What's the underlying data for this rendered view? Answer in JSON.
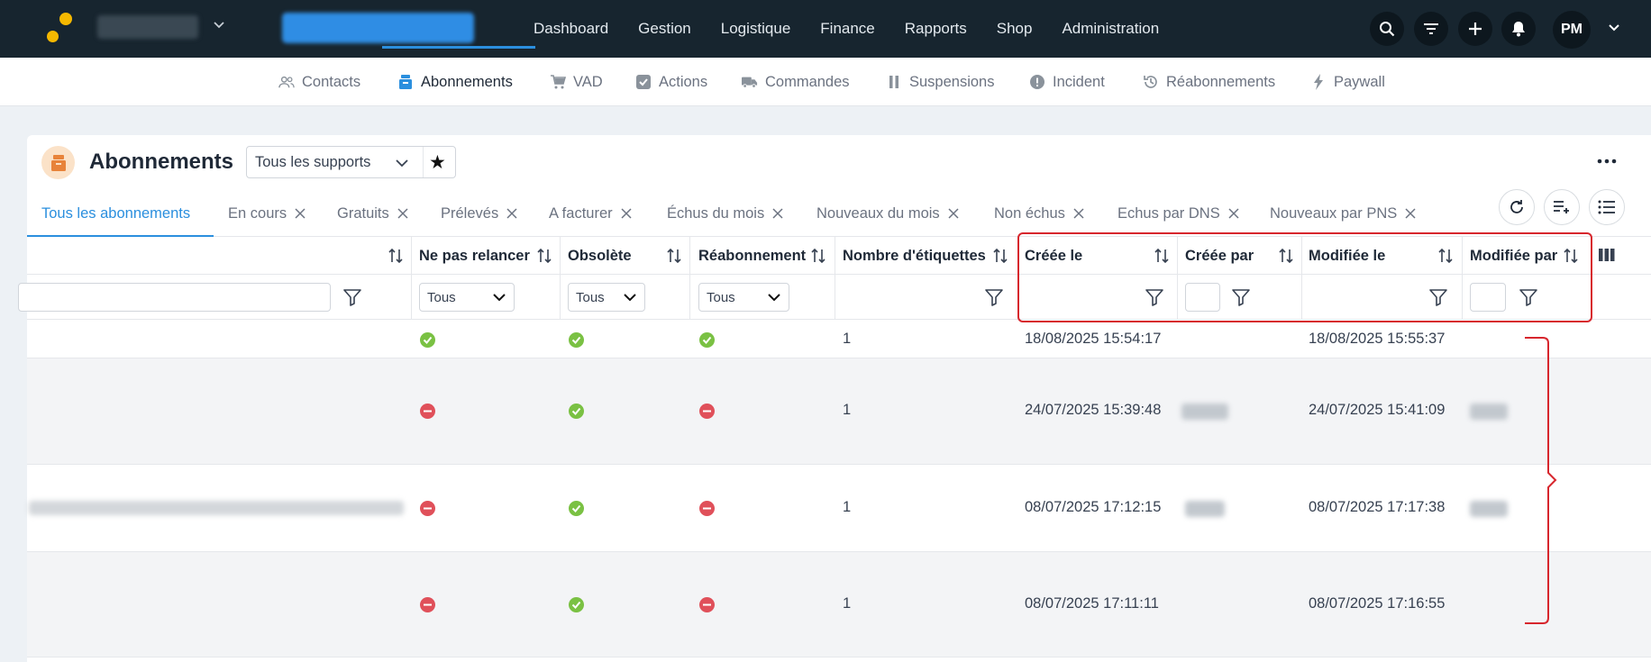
{
  "topbar": {
    "nav": [
      "Dashboard",
      "Gestion",
      "Logistique",
      "Finance",
      "Rapports",
      "Shop",
      "Administration"
    ],
    "icons": [
      "search-icon",
      "filter-icon",
      "plus-icon",
      "bell-icon"
    ],
    "user_initials": "PM"
  },
  "subnav": {
    "items": [
      {
        "label": "Contacts",
        "icon": "users-icon"
      },
      {
        "label": "Abonnements",
        "icon": "box-icon",
        "active": true
      },
      {
        "label": "VAD",
        "icon": "cart-icon"
      },
      {
        "label": "Actions",
        "icon": "checkbox-icon"
      },
      {
        "label": "Commandes",
        "icon": "truck-icon"
      },
      {
        "label": "Suspensions",
        "icon": "pause-icon"
      },
      {
        "label": "Incident",
        "icon": "alert-icon"
      },
      {
        "label": "Réabonnements",
        "icon": "history-icon"
      },
      {
        "label": "Paywall",
        "icon": "bolt-icon"
      }
    ]
  },
  "page": {
    "title": "Abonnements",
    "support_select": "Tous les supports"
  },
  "tabs": [
    {
      "label": "Tous les abonnements",
      "active": true,
      "closable": false
    },
    {
      "label": "En cours",
      "closable": true
    },
    {
      "label": "Gratuits",
      "closable": true
    },
    {
      "label": "Prélevés",
      "closable": true
    },
    {
      "label": "A facturer",
      "closable": true
    },
    {
      "label": "Échus du mois",
      "closable": true
    },
    {
      "label": "Nouveaux du mois",
      "closable": true
    },
    {
      "label": "Non échus",
      "closable": true
    },
    {
      "label": "Echus par DNS",
      "closable": true
    },
    {
      "label": "Nouveaux par PNS",
      "closable": true
    }
  ],
  "table": {
    "columns": [
      "Ne pas relancer",
      "Obsolète",
      "Réabonnement",
      "Nombre d'étiquettes",
      "Créée le",
      "Créée par",
      "Modifiée le",
      "Modifiée par"
    ],
    "filters": {
      "ne_pas_relancer": "Tous",
      "obsolete": "Tous",
      "reabonnement": "Tous"
    },
    "rows": [
      {
        "ne_pas_relancer": "yes",
        "obsolete": "yes",
        "reabonnement": "yes",
        "etiquettes": "1",
        "creee_le": "18/08/2025 15:54:17",
        "modifiee_le": "18/08/2025 15:55:37"
      },
      {
        "ne_pas_relancer": "no",
        "obsolete": "yes",
        "reabonnement": "no",
        "etiquettes": "1",
        "creee_le": "24/07/2025 15:39:48",
        "modifiee_le": "24/07/2025 15:41:09"
      },
      {
        "ne_pas_relancer": "no",
        "obsolete": "yes",
        "reabonnement": "no",
        "etiquettes": "1",
        "creee_le": "08/07/2025 17:12:15",
        "modifiee_le": "08/07/2025 17:17:38"
      },
      {
        "ne_pas_relancer": "no",
        "obsolete": "yes",
        "reabonnement": "no",
        "etiquettes": "1",
        "creee_le": "08/07/2025 17:11:11",
        "modifiee_le": "08/07/2025 17:16:55"
      }
    ]
  },
  "colors": {
    "topbar": "#17252f",
    "accent": "#2b8fde",
    "ok": "#7ac143",
    "no": "#e0505a",
    "annotation": "#d7262d"
  }
}
